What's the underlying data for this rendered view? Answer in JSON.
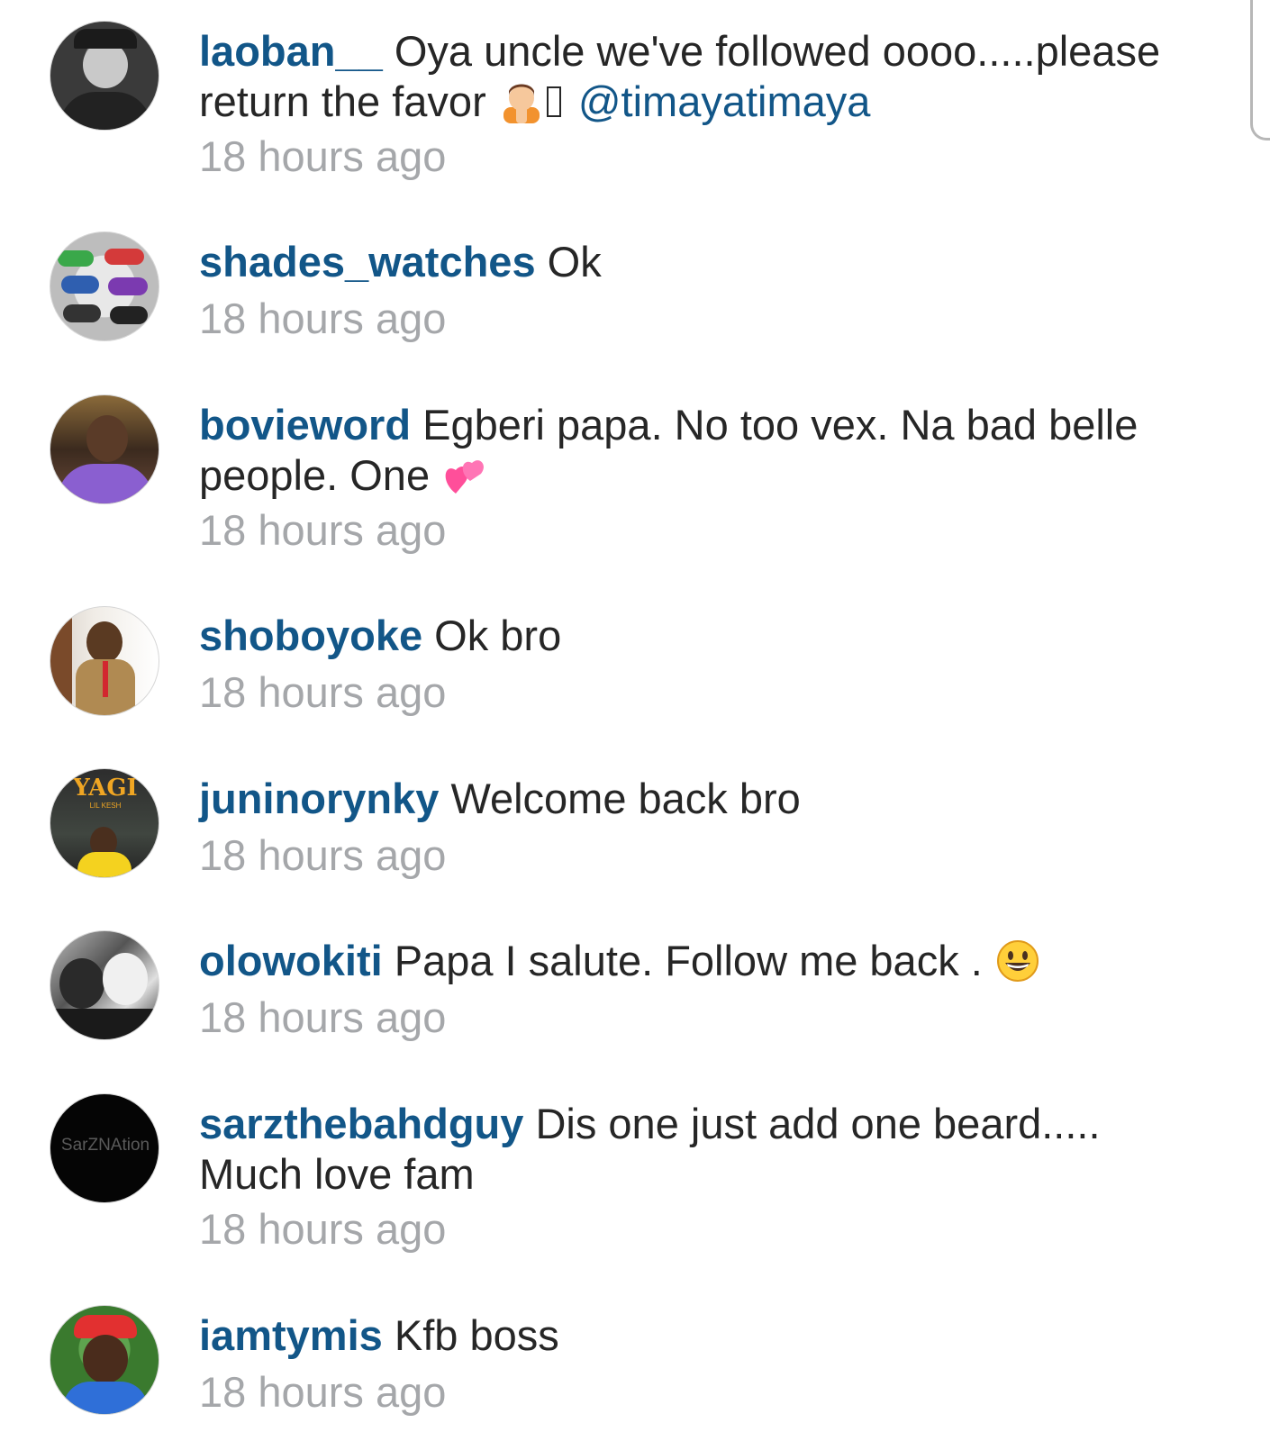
{
  "comments": [
    {
      "username": "laoban__",
      "text": "Oya uncle we've followed oooo.....please return the favor",
      "emoji": [
        "person-bowing-emoji",
        "missing-glyph"
      ],
      "mention": "@timayatimaya",
      "time": "18 hours ago"
    },
    {
      "username": "shades_watches",
      "text": "Ok",
      "time": "18 hours ago"
    },
    {
      "username": "bovieword",
      "text": "Egberi papa. No too vex. Na bad belle people. One",
      "emoji": [
        "two-hearts-emoji"
      ],
      "time": "18 hours ago"
    },
    {
      "username": "shoboyoke",
      "text": "Ok bro",
      "time": "18 hours ago"
    },
    {
      "username": "juninorynky",
      "text": "Welcome back bro",
      "time": "18 hours ago",
      "avatar_text": {
        "title": "YAGI",
        "subtitle": "LIL KESH"
      }
    },
    {
      "username": "olowokiti",
      "text": "Papa I salute. Follow me back .",
      "emoji": [
        "grinning-face-emoji"
      ],
      "time": "18 hours ago"
    },
    {
      "username": "sarzthebahdguy",
      "text": "Dis one just add one beard..... Much love fam",
      "time": "18 hours ago",
      "avatar_text": {
        "title": "SarZNAtion"
      }
    },
    {
      "username": "iamtymis",
      "text": "Kfb boss",
      "time": "18 hours ago"
    }
  ],
  "colors": {
    "username": "#125688",
    "text": "#262626",
    "time": "#a5a7aa"
  }
}
